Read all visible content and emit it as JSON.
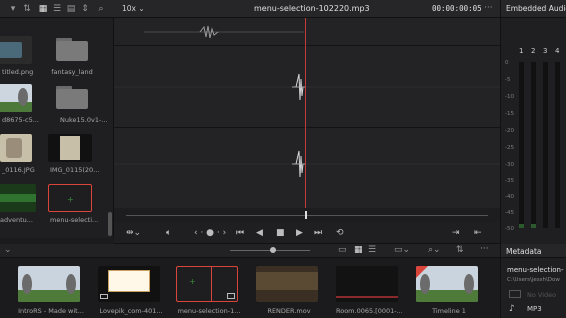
{
  "media_pool": {
    "items": [
      {
        "label": "titled.png"
      },
      {
        "label": "fantasy_land"
      },
      {
        "label": "d8675-c5..."
      },
      {
        "label": "Nuke15.0v1-..."
      },
      {
        "label": "_0116.JPG"
      },
      {
        "label": "IMG_0115(20..."
      },
      {
        "label": "adventu..."
      },
      {
        "label": "menu-selecti..."
      }
    ]
  },
  "viewer": {
    "zoom": "10x",
    "clip_title": "menu-selection-102220.mp3",
    "timecode": "00:00:00:05"
  },
  "audio_panel": {
    "title": "Embedded Audio",
    "channels": [
      "1",
      "2",
      "3",
      "4"
    ],
    "scale": [
      "0",
      "-5",
      "-10",
      "-15",
      "-20",
      "-25",
      "-30",
      "-35",
      "-40",
      "-45",
      "-50"
    ]
  },
  "filmstrip": {
    "clips": [
      {
        "label": "IntroRS - Made wit..."
      },
      {
        "label": "Lovepik_com-401..."
      },
      {
        "label": "menu-selection-1..."
      },
      {
        "label": "RENDER.mov"
      },
      {
        "label": "Room.0065.[0001-..."
      },
      {
        "label": "Timeline 1"
      }
    ]
  },
  "metadata": {
    "title": "Metadata",
    "clip_name": "menu-selection-",
    "path": "C:\\Users\\jessh\\Dow",
    "no_video": "No Video",
    "format": "MP3"
  },
  "colors": {
    "playhead": "#c43b3b",
    "selection": "#d9443b",
    "meter_green": "#2d5a2d"
  }
}
